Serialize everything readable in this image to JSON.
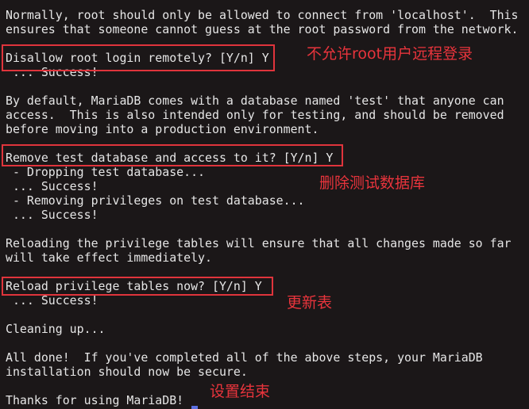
{
  "terminal": {
    "lines": [
      "Normally, root should only be allowed to connect from 'localhost'.  This",
      "ensures that someone cannot guess at the root password from the network.",
      "",
      "Disallow root login remotely? [Y/n] Y",
      " ... Success!",
      "",
      "By default, MariaDB comes with a database named 'test' that anyone can",
      "access.  This is also intended only for testing, and should be removed",
      "before moving into a production environment.",
      "",
      "Remove test database and access to it? [Y/n] Y",
      " - Dropping test database...",
      " ... Success!",
      " - Removing privileges on test database...",
      " ... Success!",
      "",
      "Reloading the privilege tables will ensure that all changes made so far",
      "will take effect immediately.",
      "",
      "Reload privilege tables now? [Y/n] Y",
      " ... Success!",
      "",
      "Cleaning up...",
      "",
      "All done!  If you've completed all of the above steps, your MariaDB",
      "installation should now be secure.",
      "",
      "Thanks for using MariaDB!"
    ]
  },
  "annotations": {
    "disallow_root": "不允许root用户远程登录",
    "remove_test_db": "删除测试数据库",
    "reload_tables": "更新表",
    "setup_done": "设置结束"
  },
  "colors": {
    "background": "#1b1718",
    "text": "#e6e6e6",
    "highlight": "#e0343c",
    "cursor": "#5a6ee0"
  }
}
